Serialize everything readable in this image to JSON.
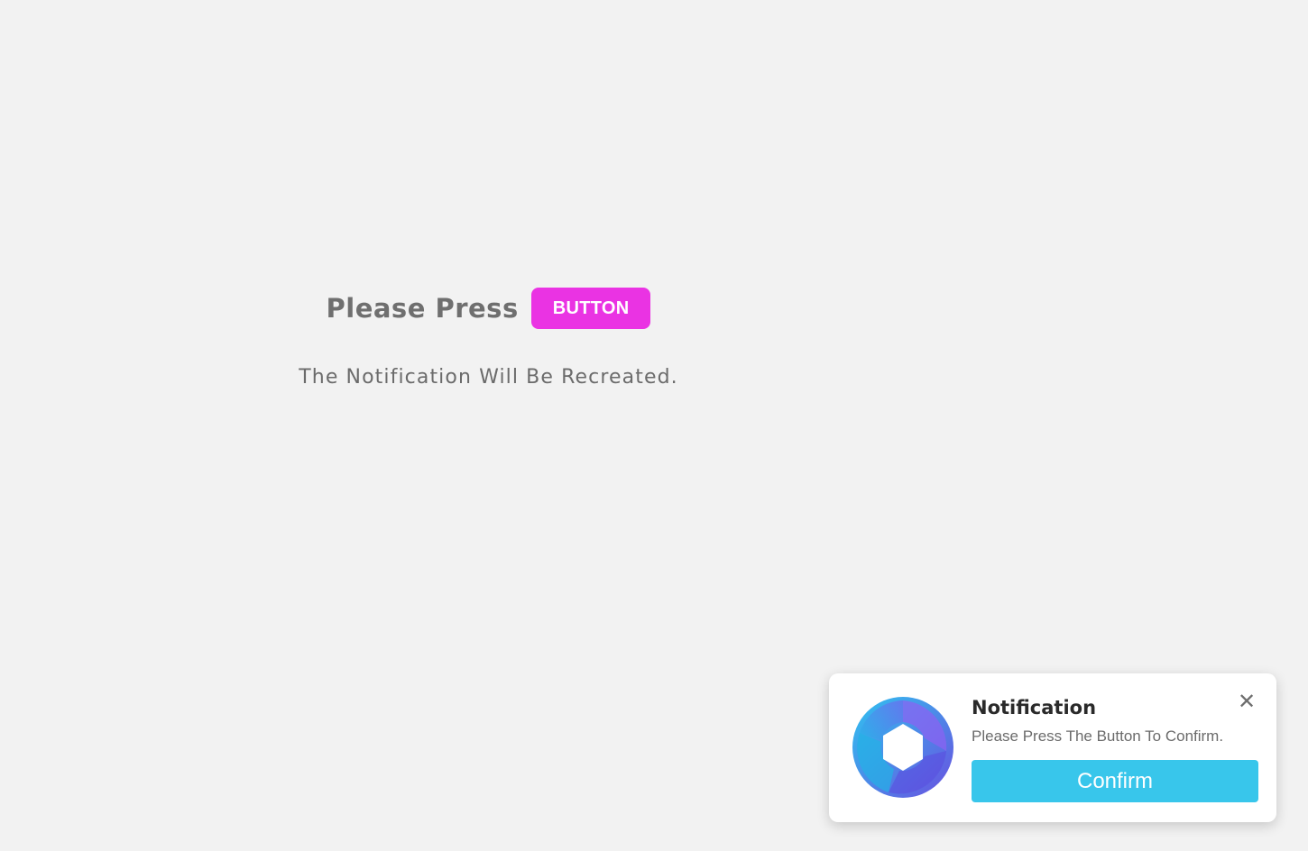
{
  "prompt": {
    "text": "Please Press",
    "button_label": "BUTTON",
    "subtext": "The Notification Will Be Recreated."
  },
  "notification": {
    "title": "Notification",
    "message": "Please Press The Button To Confirm.",
    "confirm_label": "Confirm",
    "close_icon": "close-icon",
    "logo_icon": "aperture-logo"
  },
  "colors": {
    "background": "#f2f2f2",
    "trigger_button": "#ea33e3",
    "confirm_button": "#38c6eb",
    "text_muted": "#6f6f6f",
    "toast_bg": "#ffffff"
  }
}
